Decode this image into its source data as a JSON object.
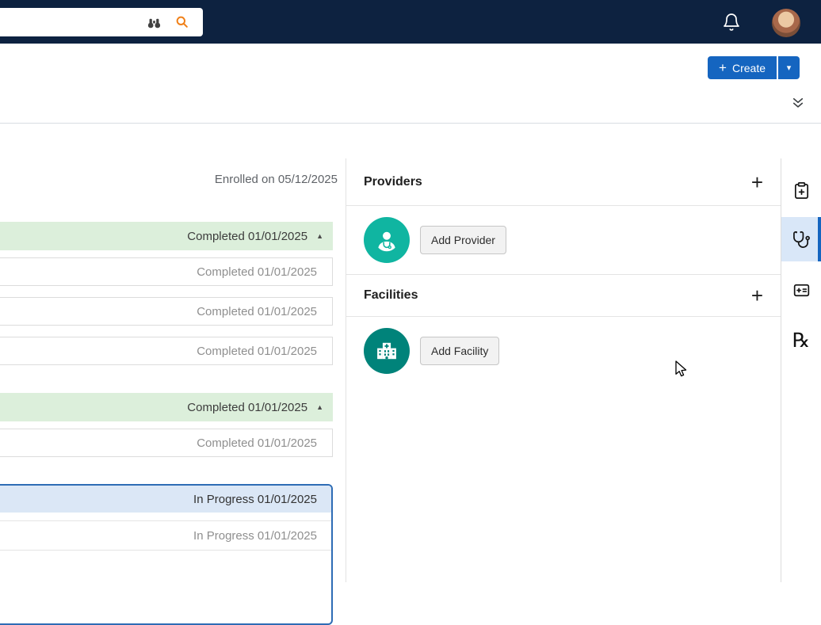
{
  "colors": {
    "navy": "#0d2240",
    "accent_blue": "#1565c0",
    "teal_provider": "#10b5a1",
    "teal_facility": "#00837a",
    "green_row_bg": "#dcefdb",
    "blue_row_bg": "#dbe7f6",
    "selected_border": "#2e6cb5",
    "search_orange": "#f08019"
  },
  "icons": {
    "binoculars": "binoculars",
    "search": "magnifier",
    "bell": "notification-bell",
    "avatar": "user-photo",
    "create_plus": "+",
    "create_caret": "▾",
    "expand_all": "double-chevron-down",
    "collapse": "▲",
    "add": "+",
    "rx_glyph": "℞",
    "rail": [
      "clipboard-plus",
      "stethoscope",
      "id-card",
      "prescription-rx"
    ]
  },
  "topbar": {
    "search_value": ""
  },
  "action_bar": {
    "create_label": "Create"
  },
  "enrollment": {
    "label": "Enrolled on 05/12/2025"
  },
  "timeline": {
    "groups": [
      {
        "status": "completed",
        "header_label": "Completed 01/01/2025",
        "items": [
          {
            "label": "Completed 01/01/2025"
          },
          {
            "label": "Completed 01/01/2025"
          },
          {
            "label": "Completed 01/01/2025"
          }
        ]
      },
      {
        "status": "completed",
        "header_label": "Completed 01/01/2025",
        "items": [
          {
            "label": "Completed 01/01/2025"
          }
        ]
      },
      {
        "status": "in_progress",
        "selected": true,
        "header_label": "In Progress 01/01/2025",
        "items": [
          {
            "label": "In Progress 01/01/2025"
          }
        ]
      }
    ]
  },
  "providers_panel": {
    "title": "Providers",
    "add_button_label": "Add Provider"
  },
  "facilities_panel": {
    "title": "Facilities",
    "add_button_label": "Add Facility"
  }
}
